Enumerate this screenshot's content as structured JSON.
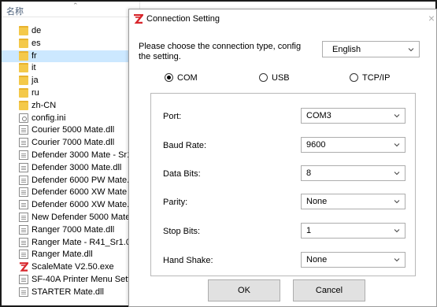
{
  "explorer": {
    "column_header": "名称",
    "files": [
      {
        "name": "de",
        "type": "folder"
      },
      {
        "name": "es",
        "type": "folder"
      },
      {
        "name": "fr",
        "type": "folder",
        "selected": true
      },
      {
        "name": "it",
        "type": "folder"
      },
      {
        "name": "ja",
        "type": "folder"
      },
      {
        "name": "ru",
        "type": "folder"
      },
      {
        "name": "zh-CN",
        "type": "folder"
      },
      {
        "name": "config.ini",
        "type": "config"
      },
      {
        "name": "Courier 5000 Mate.dll",
        "type": "file"
      },
      {
        "name": "Courier 7000 Mate.dll",
        "type": "file"
      },
      {
        "name": "Defender 3000 Mate - Sr1.03",
        "type": "file"
      },
      {
        "name": "Defender 3000 Mate.dll",
        "type": "file"
      },
      {
        "name": "Defender 6000 PW Mate.dll",
        "type": "file"
      },
      {
        "name": "Defender 6000 XW Mate - S",
        "type": "file"
      },
      {
        "name": "Defender 6000 XW Mate.dll",
        "type": "file"
      },
      {
        "name": "New Defender 5000 Mate.dl",
        "type": "file"
      },
      {
        "name": "Ranger 7000 Mate.dll",
        "type": "file"
      },
      {
        "name": "Ranger Mate - R41_Sr1.02.dl",
        "type": "file"
      },
      {
        "name": "Ranger Mate.dll",
        "type": "file"
      },
      {
        "name": "ScaleMate V2.50.exe",
        "type": "app"
      },
      {
        "name": "SF-40A Printer Menu Setting.",
        "type": "file"
      },
      {
        "name": "STARTER Mate.dll",
        "type": "file"
      }
    ]
  },
  "dialog": {
    "title": "Connection Setting",
    "close_glyph": "×",
    "intro": "Please choose the connection type, config the setting.",
    "language": "English",
    "connection_types": [
      {
        "label": "COM",
        "selected": true
      },
      {
        "label": "USB",
        "selected": false
      },
      {
        "label": "TCP/IP",
        "selected": false
      }
    ],
    "params": [
      {
        "label": "Port:",
        "value": "COM3"
      },
      {
        "label": "Baud Rate:",
        "value": "9600"
      },
      {
        "label": "Data Bits:",
        "value": "8"
      },
      {
        "label": "Parity:",
        "value": "None"
      },
      {
        "label": "Stop Bits:",
        "value": "1"
      },
      {
        "label": "Hand Shake:",
        "value": "None"
      }
    ],
    "ok_label": "OK",
    "cancel_label": "Cancel"
  },
  "colors": {
    "folder": "#f4c94a",
    "selection": "#cce8ff",
    "app_icon": "#d8262c",
    "button_face": "#e1e1e1"
  },
  "icons": {
    "folder": "folder-icon",
    "file": "file-icon",
    "config": "config-file-icon",
    "app": "scalemate-app-icon",
    "dropdown": "chevron-down-icon"
  }
}
